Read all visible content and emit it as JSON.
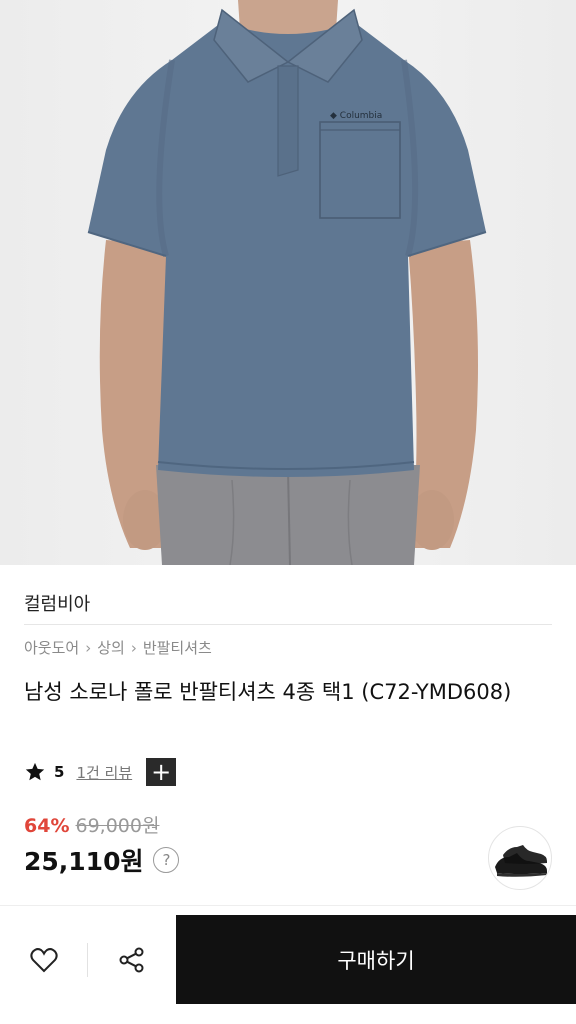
{
  "product": {
    "brand": "컬럼비아",
    "breadcrumb": [
      "아웃도어",
      "상의",
      "반팔티셔츠"
    ],
    "title": "남성 소로나 폴로 반팔티셔츠 4종 택1 (C72-YMD608)",
    "rating": {
      "score": "5",
      "review_link": "1건 리뷰",
      "expand_symbol": "+"
    },
    "discount_rate": "64%",
    "original_price": "69,000원",
    "price": "25,110원",
    "price_info_symbol": "?",
    "shirt_logo_text": "Columbia"
  },
  "bottom_bar": {
    "buy_label": "구매하기"
  },
  "colors": {
    "shirt": "#5f7792",
    "discount": "#e0463a",
    "buy_button": "#111111"
  },
  "icons": {
    "wishlist": "heart-icon",
    "share": "share-icon",
    "rating": "star-icon"
  }
}
